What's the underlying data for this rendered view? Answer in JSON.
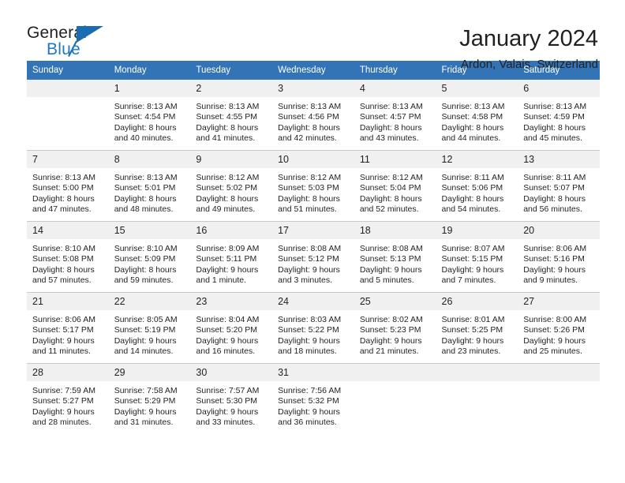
{
  "brand": {
    "word_one": "General",
    "word_two": "Blue",
    "triangle_icon": "triangle-icon",
    "accent_color": "#1b6cb0"
  },
  "header": {
    "month_title": "January 2024",
    "location": "Ardon, Valais, Switzerland"
  },
  "calendar": {
    "header_bg": "#3274b5",
    "daynum_bg": "#f0f0f0",
    "weekday_headers": [
      "Sunday",
      "Monday",
      "Tuesday",
      "Wednesday",
      "Thursday",
      "Friday",
      "Saturday"
    ],
    "weeks": [
      [
        {
          "day": "",
          "lines": []
        },
        {
          "day": "1",
          "lines": [
            "Sunrise: 8:13 AM",
            "Sunset: 4:54 PM",
            "Daylight: 8 hours",
            "and 40 minutes."
          ]
        },
        {
          "day": "2",
          "lines": [
            "Sunrise: 8:13 AM",
            "Sunset: 4:55 PM",
            "Daylight: 8 hours",
            "and 41 minutes."
          ]
        },
        {
          "day": "3",
          "lines": [
            "Sunrise: 8:13 AM",
            "Sunset: 4:56 PM",
            "Daylight: 8 hours",
            "and 42 minutes."
          ]
        },
        {
          "day": "4",
          "lines": [
            "Sunrise: 8:13 AM",
            "Sunset: 4:57 PM",
            "Daylight: 8 hours",
            "and 43 minutes."
          ]
        },
        {
          "day": "5",
          "lines": [
            "Sunrise: 8:13 AM",
            "Sunset: 4:58 PM",
            "Daylight: 8 hours",
            "and 44 minutes."
          ]
        },
        {
          "day": "6",
          "lines": [
            "Sunrise: 8:13 AM",
            "Sunset: 4:59 PM",
            "Daylight: 8 hours",
            "and 45 minutes."
          ]
        }
      ],
      [
        {
          "day": "7",
          "lines": [
            "Sunrise: 8:13 AM",
            "Sunset: 5:00 PM",
            "Daylight: 8 hours",
            "and 47 minutes."
          ]
        },
        {
          "day": "8",
          "lines": [
            "Sunrise: 8:13 AM",
            "Sunset: 5:01 PM",
            "Daylight: 8 hours",
            "and 48 minutes."
          ]
        },
        {
          "day": "9",
          "lines": [
            "Sunrise: 8:12 AM",
            "Sunset: 5:02 PM",
            "Daylight: 8 hours",
            "and 49 minutes."
          ]
        },
        {
          "day": "10",
          "lines": [
            "Sunrise: 8:12 AM",
            "Sunset: 5:03 PM",
            "Daylight: 8 hours",
            "and 51 minutes."
          ]
        },
        {
          "day": "11",
          "lines": [
            "Sunrise: 8:12 AM",
            "Sunset: 5:04 PM",
            "Daylight: 8 hours",
            "and 52 minutes."
          ]
        },
        {
          "day": "12",
          "lines": [
            "Sunrise: 8:11 AM",
            "Sunset: 5:06 PM",
            "Daylight: 8 hours",
            "and 54 minutes."
          ]
        },
        {
          "day": "13",
          "lines": [
            "Sunrise: 8:11 AM",
            "Sunset: 5:07 PM",
            "Daylight: 8 hours",
            "and 56 minutes."
          ]
        }
      ],
      [
        {
          "day": "14",
          "lines": [
            "Sunrise: 8:10 AM",
            "Sunset: 5:08 PM",
            "Daylight: 8 hours",
            "and 57 minutes."
          ]
        },
        {
          "day": "15",
          "lines": [
            "Sunrise: 8:10 AM",
            "Sunset: 5:09 PM",
            "Daylight: 8 hours",
            "and 59 minutes."
          ]
        },
        {
          "day": "16",
          "lines": [
            "Sunrise: 8:09 AM",
            "Sunset: 5:11 PM",
            "Daylight: 9 hours",
            "and 1 minute."
          ]
        },
        {
          "day": "17",
          "lines": [
            "Sunrise: 8:08 AM",
            "Sunset: 5:12 PM",
            "Daylight: 9 hours",
            "and 3 minutes."
          ]
        },
        {
          "day": "18",
          "lines": [
            "Sunrise: 8:08 AM",
            "Sunset: 5:13 PM",
            "Daylight: 9 hours",
            "and 5 minutes."
          ]
        },
        {
          "day": "19",
          "lines": [
            "Sunrise: 8:07 AM",
            "Sunset: 5:15 PM",
            "Daylight: 9 hours",
            "and 7 minutes."
          ]
        },
        {
          "day": "20",
          "lines": [
            "Sunrise: 8:06 AM",
            "Sunset: 5:16 PM",
            "Daylight: 9 hours",
            "and 9 minutes."
          ]
        }
      ],
      [
        {
          "day": "21",
          "lines": [
            "Sunrise: 8:06 AM",
            "Sunset: 5:17 PM",
            "Daylight: 9 hours",
            "and 11 minutes."
          ]
        },
        {
          "day": "22",
          "lines": [
            "Sunrise: 8:05 AM",
            "Sunset: 5:19 PM",
            "Daylight: 9 hours",
            "and 14 minutes."
          ]
        },
        {
          "day": "23",
          "lines": [
            "Sunrise: 8:04 AM",
            "Sunset: 5:20 PM",
            "Daylight: 9 hours",
            "and 16 minutes."
          ]
        },
        {
          "day": "24",
          "lines": [
            "Sunrise: 8:03 AM",
            "Sunset: 5:22 PM",
            "Daylight: 9 hours",
            "and 18 minutes."
          ]
        },
        {
          "day": "25",
          "lines": [
            "Sunrise: 8:02 AM",
            "Sunset: 5:23 PM",
            "Daylight: 9 hours",
            "and 21 minutes."
          ]
        },
        {
          "day": "26",
          "lines": [
            "Sunrise: 8:01 AM",
            "Sunset: 5:25 PM",
            "Daylight: 9 hours",
            "and 23 minutes."
          ]
        },
        {
          "day": "27",
          "lines": [
            "Sunrise: 8:00 AM",
            "Sunset: 5:26 PM",
            "Daylight: 9 hours",
            "and 25 minutes."
          ]
        }
      ],
      [
        {
          "day": "28",
          "lines": [
            "Sunrise: 7:59 AM",
            "Sunset: 5:27 PM",
            "Daylight: 9 hours",
            "and 28 minutes."
          ]
        },
        {
          "day": "29",
          "lines": [
            "Sunrise: 7:58 AM",
            "Sunset: 5:29 PM",
            "Daylight: 9 hours",
            "and 31 minutes."
          ]
        },
        {
          "day": "30",
          "lines": [
            "Sunrise: 7:57 AM",
            "Sunset: 5:30 PM",
            "Daylight: 9 hours",
            "and 33 minutes."
          ]
        },
        {
          "day": "31",
          "lines": [
            "Sunrise: 7:56 AM",
            "Sunset: 5:32 PM",
            "Daylight: 9 hours",
            "and 36 minutes."
          ]
        },
        {
          "day": "",
          "lines": []
        },
        {
          "day": "",
          "lines": []
        },
        {
          "day": "",
          "lines": []
        }
      ]
    ]
  }
}
